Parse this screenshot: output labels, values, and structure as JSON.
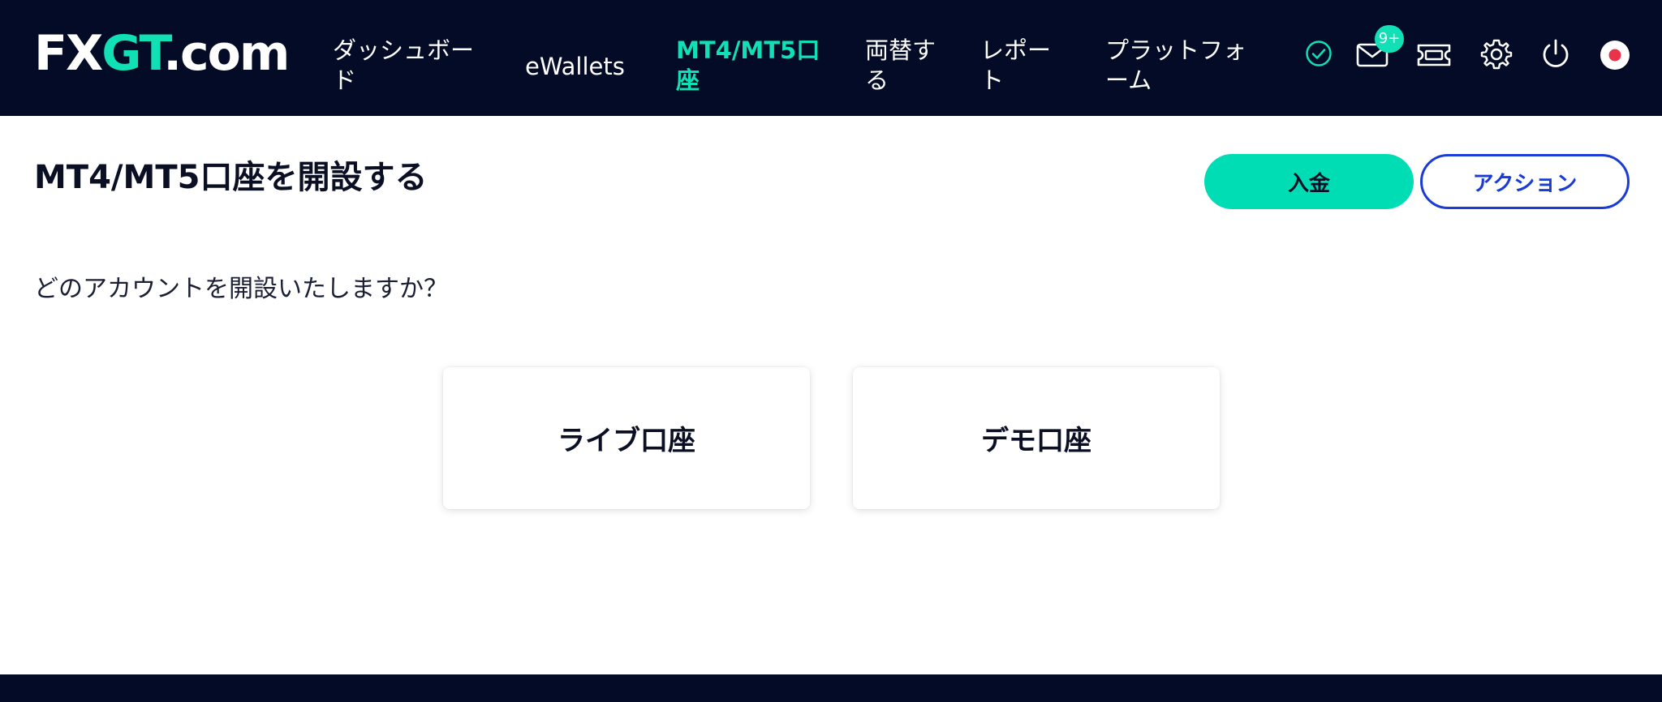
{
  "logo": {
    "fx": "FX",
    "gt": "GT",
    "dom": ".com"
  },
  "nav": {
    "dashboard": [
      "ダッシュボー",
      "ド"
    ],
    "ewallets": "eWallets",
    "accounts": [
      "MT4/MT5口",
      "座"
    ],
    "exchange": [
      "両替す",
      "る"
    ],
    "report": [
      "レポー",
      "ト"
    ],
    "platform": [
      "プラットフォ",
      "ーム"
    ]
  },
  "header_icons": {
    "verified": "check-circle-icon",
    "mail": "mail-icon",
    "mail_badge": "9+",
    "ticket": "ticket-icon",
    "settings": "gear-icon",
    "logout": "power-icon",
    "language": "japan-flag-icon"
  },
  "page": {
    "title": "MT4/MT5口座を開設する",
    "deposit_label": "入金",
    "action_label": "アクション",
    "question": "どのアカウントを開設いたしますか？",
    "live_card": "ライブ口座",
    "demo_card": "デモ口座"
  },
  "colors": {
    "header_bg": "#030b26",
    "accent": "#11dfb5",
    "action_blue": "#1a3bd6"
  }
}
